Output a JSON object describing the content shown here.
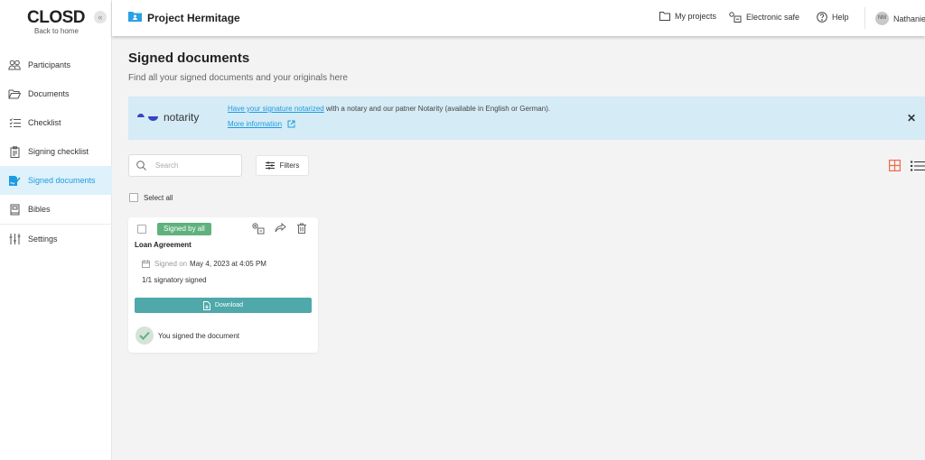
{
  "sidebar": {
    "logo": "CLOSD",
    "back_label": "Back to home",
    "collapse_glyph": "«",
    "items": [
      {
        "label": "Participants",
        "icon": "participants-icon"
      },
      {
        "label": "Documents",
        "icon": "folder-open-icon"
      },
      {
        "label": "Checklist",
        "icon": "checklist-icon"
      },
      {
        "label": "Signing checklist",
        "icon": "clipboard-icon"
      },
      {
        "label": "Signed documents",
        "icon": "signed-document-icon",
        "active": true
      },
      {
        "label": "Bibles",
        "icon": "book-icon"
      },
      {
        "label": "Settings",
        "icon": "sliders-icon"
      }
    ]
  },
  "header": {
    "project_title": "Project Hermitage",
    "nav": [
      {
        "label": "My projects",
        "icon": "folder-icon"
      },
      {
        "label": "Electronic safe",
        "icon": "safe-icon"
      },
      {
        "label": "Help",
        "icon": "help-icon"
      }
    ],
    "user": {
      "initials": "NM",
      "name": "Nathanie"
    }
  },
  "page": {
    "title": "Signed documents",
    "subtitle": "Find all your signed documents and your originals here"
  },
  "banner": {
    "brand": "notarity",
    "link_text": "Have your signature notarized",
    "text": " with a notary and our patner Notarity (available in English or German).",
    "more_label": "More information",
    "close_glyph": "✕"
  },
  "toolbar": {
    "search_placeholder": "Search",
    "search_value": "",
    "filters_label": "Filters",
    "select_all_label": "Select all"
  },
  "colors": {
    "accent": "#1c9ce0",
    "badge_green": "#5fb27c",
    "download_teal": "#4fa8a9",
    "grid_view_active": "#f06a4a"
  },
  "documents": [
    {
      "status": "Signed by all",
      "title": "Loan Agreement",
      "signed_prefix": "Signed on",
      "signed_date": "May 4, 2023 at 4:05 PM",
      "signatories": "1/1 signatory signed",
      "download_label": "Download",
      "you_signed": "You signed the document"
    }
  ]
}
